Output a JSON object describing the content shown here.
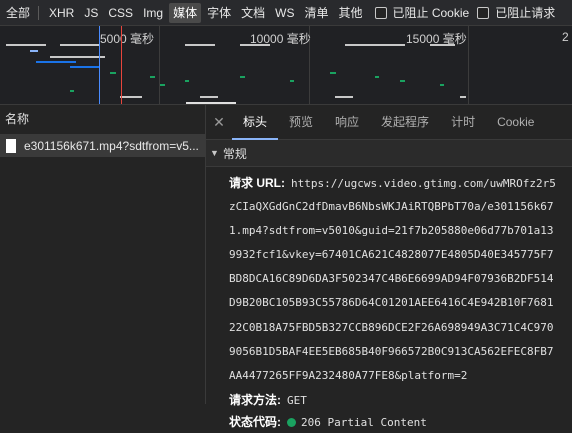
{
  "filter_bar": {
    "tabs": [
      {
        "label": "全部",
        "active": false
      },
      {
        "label": "XHR",
        "active": false
      },
      {
        "label": "JS",
        "active": false
      },
      {
        "label": "CSS",
        "active": false
      },
      {
        "label": "Img",
        "active": false
      },
      {
        "label": "媒体",
        "active": true
      },
      {
        "label": "字体",
        "active": false
      },
      {
        "label": "文档",
        "active": false
      },
      {
        "label": "WS",
        "active": false
      },
      {
        "label": "清单",
        "active": false
      },
      {
        "label": "其他",
        "active": false
      }
    ],
    "block_cookies_label": "已阻止 Cookie",
    "blocked_requests_label": "已阻止请求"
  },
  "overview": {
    "ticks": [
      "5000 毫秒",
      "10000 毫秒",
      "15000 毫秒",
      "2"
    ]
  },
  "request_list": {
    "header": "名称",
    "rows": [
      {
        "name": "e301156k671.mp4?sdtfrom=v5..."
      }
    ]
  },
  "details": {
    "close_icon": "close-icon",
    "tabs": [
      {
        "label": "标头",
        "active": true
      },
      {
        "label": "预览",
        "active": false
      },
      {
        "label": "响应",
        "active": false
      },
      {
        "label": "发起程序",
        "active": false
      },
      {
        "label": "计时",
        "active": false
      },
      {
        "label": "Cookie",
        "active": false
      }
    ],
    "section_title": "常规",
    "request_url_label": "请求 URL:",
    "request_url_lines": [
      "https://ugcws.video.gtimg.com/uwMROfz2r5",
      "zCIaQXGdGnC2dfDmavB6NbsWKJAiRTQBPbT70a/e301156k67",
      "1.mp4?sdtfrom=v5010&guid=21f7b205880e06d77b701a13",
      "9932fcf1&vkey=67401CA621C4828077E4805D40E345775F7",
      "BD8DCA16C89D6DA3F502347C4B6E6699AD94F07936B2DF514",
      "D9B20BC105B93C55786D64C01201AEE6416C4E942B10F7681",
      "22C0B18A75FBD5B327CCB896DCE2F26A698949A3C71C4C970",
      "9056B1D5BAF4EE5EB685B40F966572B0C913CA562EFEC8FB7",
      "AA4477265FF9A232480A77FE8&platform=2"
    ],
    "request_method_label": "请求方法:",
    "request_method_value": "GET",
    "status_code_label": "状态代码:",
    "status_code_value": "206 Partial Content",
    "status_color": "#1aa260"
  }
}
